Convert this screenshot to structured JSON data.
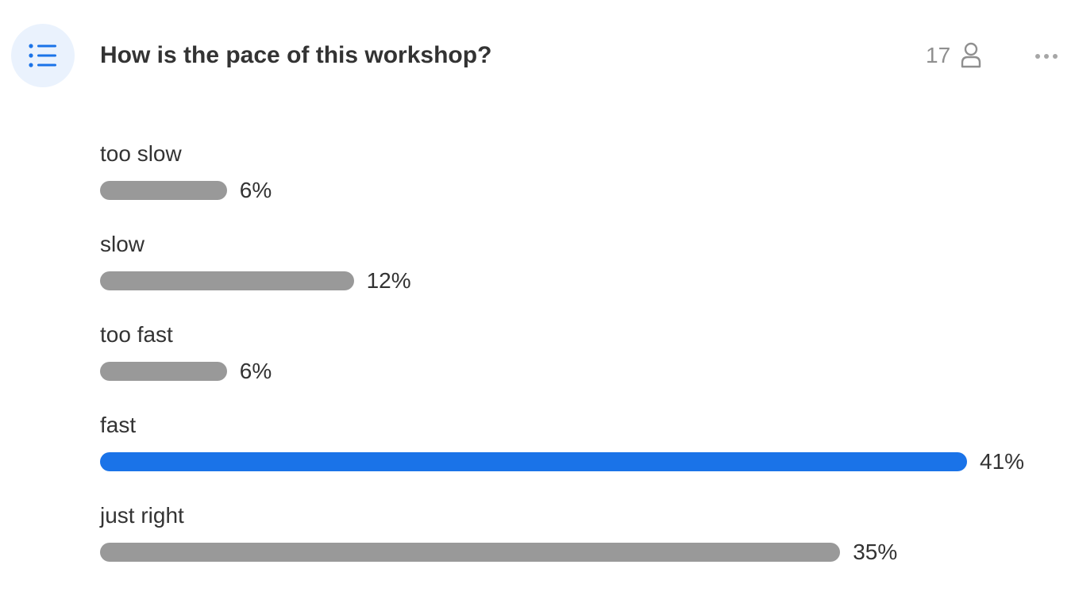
{
  "question": {
    "title": "How is the pace of this workshop?",
    "participant_count": "17",
    "icon": "list-icon",
    "participants_icon": "person-icon",
    "menu_icon": "more-horizontal-icon"
  },
  "colors": {
    "accent": "#1a73e8",
    "bar_default": "#999999",
    "icon_bg": "#eaf2fd",
    "muted_text": "#8f8f8f"
  },
  "options": [
    {
      "label": "too slow",
      "percent_label": "6%",
      "percent": 6,
      "highlight": false
    },
    {
      "label": "slow",
      "percent_label": "12%",
      "percent": 12,
      "highlight": false
    },
    {
      "label": "too fast",
      "percent_label": "6%",
      "percent": 6,
      "highlight": false
    },
    {
      "label": "fast",
      "percent_label": "41%",
      "percent": 41,
      "highlight": true
    },
    {
      "label": "just right",
      "percent_label": "35%",
      "percent": 35,
      "highlight": false
    }
  ]
}
